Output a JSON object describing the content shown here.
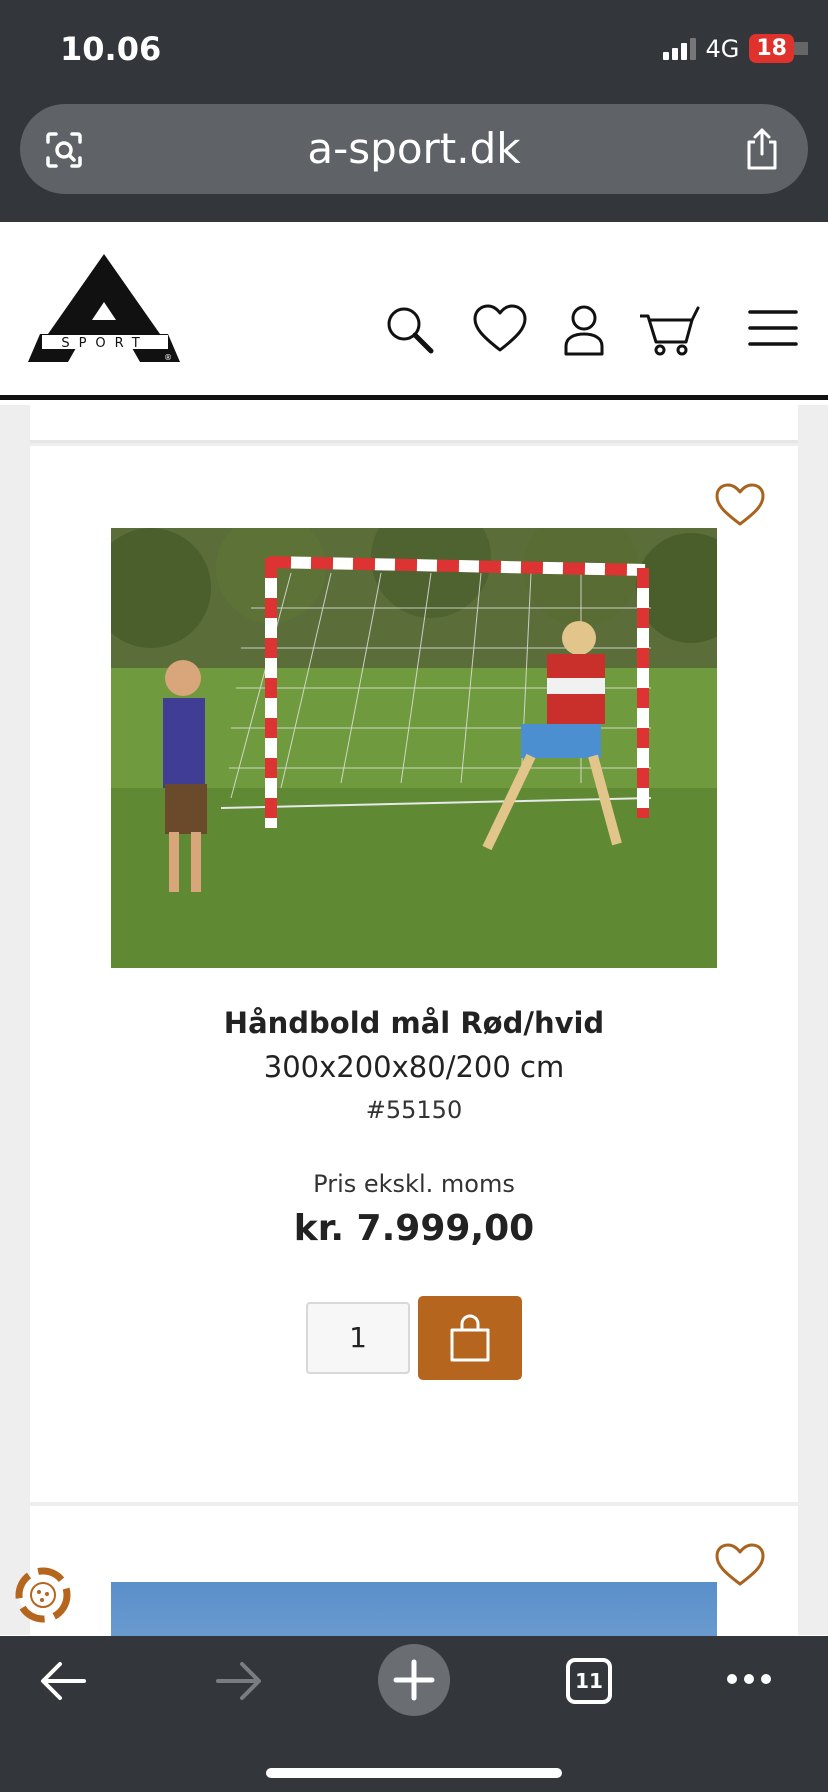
{
  "status": {
    "time": "10.06",
    "network": "4G",
    "battery": "18"
  },
  "browser": {
    "url": "a-sport.dk",
    "tabs_count": "11"
  },
  "site": {
    "logo_text": "SPORT"
  },
  "product": {
    "title": "Håndbold mål Rød/hvid",
    "subtitle": "300x200x80/200 cm",
    "sku": "#55150",
    "price_label": "Pris ekskl. moms",
    "price": "kr. 7.999,00",
    "quantity": "1"
  },
  "colors": {
    "accent": "#b5651d",
    "chrome": "#33363a",
    "address_bar": "#5f6266"
  },
  "icons": [
    "search-icon",
    "heart-icon",
    "user-icon",
    "cart-icon",
    "menu-icon",
    "bag-icon",
    "back-icon",
    "forward-icon",
    "plus-icon",
    "more-icon",
    "share-icon",
    "cookie-icon"
  ]
}
